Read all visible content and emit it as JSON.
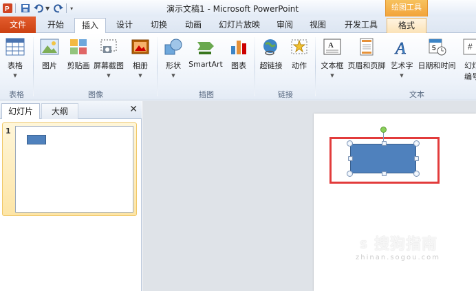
{
  "window": {
    "title": "演示文稿1 - Microsoft PowerPoint",
    "context_tools": "绘图工具"
  },
  "tabs": {
    "file": "文件",
    "home": "开始",
    "insert": "插入",
    "design": "设计",
    "transitions": "切换",
    "animations": "动画",
    "slideshow": "幻灯片放映",
    "review": "审阅",
    "view": "视图",
    "developer": "开发工具",
    "format": "格式"
  },
  "ribbon": {
    "table": "表格",
    "picture": "图片",
    "clipart": "剪贴画",
    "screenshot": "屏幕截图",
    "album": "相册",
    "shapes": "形状",
    "smartart": "SmartArt",
    "chart": "图表",
    "hyperlink": "超链接",
    "action": "动作",
    "textbox": "文本框",
    "header_footer": "页眉和页脚",
    "wordart": "艺术字",
    "datetime": "日期和时间",
    "slide_number_1": "幻灯",
    "slide_number_2": "编号",
    "groups": {
      "tables": "表格",
      "images": "图像",
      "illustrations": "插图",
      "links": "链接",
      "text": "文本"
    }
  },
  "left_panel": {
    "tab_slides": "幻灯片",
    "tab_outline": "大纲",
    "close": "✕",
    "slide_number": "1"
  },
  "watermark": {
    "text": "搜狗指南",
    "logo": "S",
    "url": "zhinan.sogou.com"
  },
  "colors": {
    "shape_fill": "#4f81bd",
    "highlight": "#e23b3b",
    "file_tab": "#d24d1d",
    "context_tab": "#f2a33a"
  }
}
